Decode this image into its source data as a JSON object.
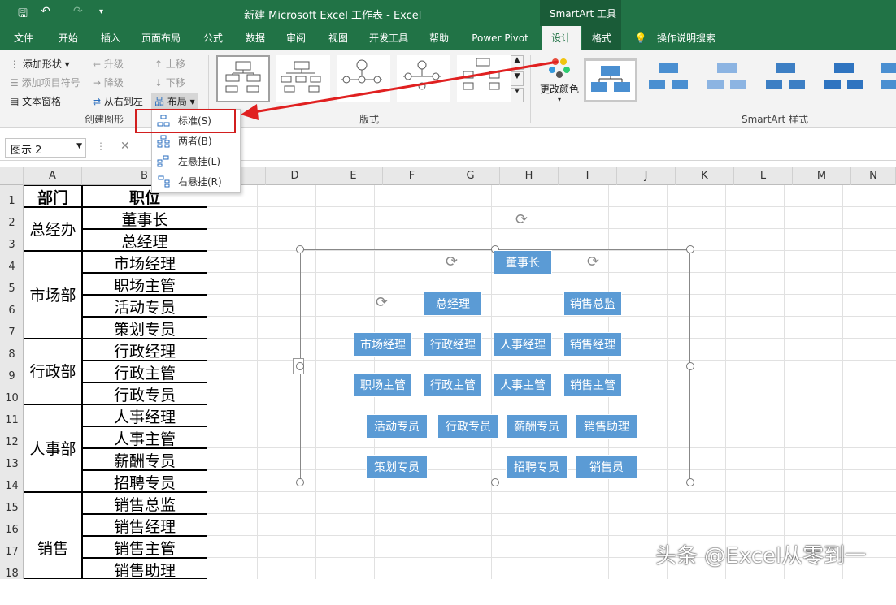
{
  "titlebar": {
    "save_icon": "save-icon",
    "undo_icon": "undo-icon",
    "redo_icon": "redo-icon",
    "title": "新建 Microsoft Excel 工作表 - Excel",
    "contextual": "SmartArt 工具"
  },
  "tabs": [
    "文件",
    "开始",
    "插入",
    "页面布局",
    "公式",
    "数据",
    "审阅",
    "视图",
    "开发工具",
    "帮助",
    "Power Pivot",
    "设计",
    "格式",
    "操作说明搜索"
  ],
  "ribbon": {
    "add_shape": "添加形状",
    "add_bullet": "添加项目符号",
    "text_pane": "文本窗格",
    "promote": "升级",
    "demote": "降级",
    "rtl": "从右到左",
    "move_up": "上移",
    "move_down": "下移",
    "layout": "布局",
    "group_create": "创建图形",
    "group_layouts": "版式",
    "change_colors": "更改颜色",
    "group_styles": "SmartArt 样式"
  },
  "layout_menu": [
    {
      "label": "标准(S)"
    },
    {
      "label": "两者(B)"
    },
    {
      "label": "左悬挂(L)"
    },
    {
      "label": "右悬挂(R)"
    }
  ],
  "formula": {
    "namebox": "图示 2",
    "cancel": "✕"
  },
  "columns": [
    "A",
    "B",
    "C",
    "D",
    "E",
    "F",
    "G",
    "H",
    "I",
    "J",
    "K",
    "L",
    "M",
    "N"
  ],
  "rows": [
    "1",
    "2",
    "3",
    "4",
    "5",
    "6",
    "7",
    "8",
    "9",
    "10",
    "11",
    "12",
    "13",
    "14",
    "15",
    "16",
    "17",
    "18"
  ],
  "table": {
    "header_dept": "部门",
    "header_pos": "职位",
    "depts": [
      "总经办",
      "市场部",
      "行政部",
      "人事部",
      "销售"
    ],
    "positions": [
      "董事长",
      "总经理",
      "市场经理",
      "职场主管",
      "活动专员",
      "策划专员",
      "行政经理",
      "行政主管",
      "行政专员",
      "人事经理",
      "人事主管",
      "薪酬专员",
      "招聘专员",
      "销售总监",
      "销售经理",
      "销售主管",
      "销售助理"
    ]
  },
  "smartart_nodes": [
    "董事长",
    "总经理",
    "销售总监",
    "市场经理",
    "行政经理",
    "人事经理",
    "销售经理",
    "职场主管",
    "行政主管",
    "人事主管",
    "销售主管",
    "活动专员",
    "行政专员",
    "薪酬专员",
    "销售助理",
    "策划专员",
    "招聘专员",
    "销售员"
  ],
  "watermark": "头条 @Excel从零到一"
}
